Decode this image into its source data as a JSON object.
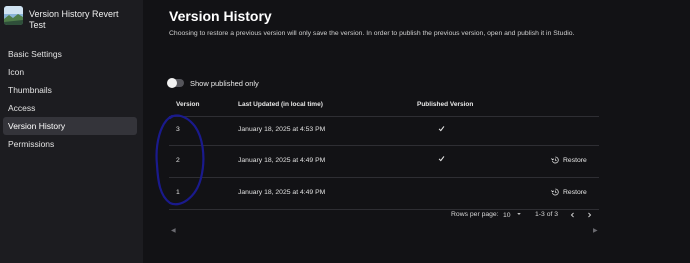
{
  "sidebar": {
    "place_title": "Version History Revert Test",
    "items": [
      {
        "label": "Basic Settings",
        "active": false
      },
      {
        "label": "Icon",
        "active": false
      },
      {
        "label": "Thumbnails",
        "active": false
      },
      {
        "label": "Access",
        "active": false
      },
      {
        "label": "Version History",
        "active": true
      },
      {
        "label": "Permissions",
        "active": false
      }
    ]
  },
  "main": {
    "title": "Version History",
    "description": "Choosing to restore a previous version will only save the version. In order to publish the previous version, open and publish it in Studio.",
    "toggle": {
      "label": "Show published only",
      "checked": false
    },
    "table": {
      "headers": {
        "version": "Version",
        "last_updated": "Last Updated (in local time)",
        "published": "Published Version"
      },
      "rows": [
        {
          "version": "3",
          "updated": "January 18, 2025 at 4:53 PM",
          "published": true,
          "restore_label": ""
        },
        {
          "version": "2",
          "updated": "January 18, 2025 at 4:49 PM",
          "published": true,
          "restore_label": "Restore"
        },
        {
          "version": "1",
          "updated": "January 18, 2025 at 4:49 PM",
          "published": false,
          "restore_label": "Restore"
        }
      ]
    },
    "pagination": {
      "rows_per_page_label": "Rows per page:",
      "rows_per_page_value": "10",
      "range_label": "1-3 of 3"
    }
  },
  "colors": {
    "background": "#121215",
    "sidebar": "#1c1c20",
    "active_item": "#34343a",
    "annotation_ink": "#1a1a8c"
  },
  "icons": {
    "check": "checkmark-icon",
    "restore": "history-restore-icon",
    "dropdown": "caret-down-icon",
    "prev": "chevron-left-icon",
    "next": "chevron-right-icon"
  }
}
